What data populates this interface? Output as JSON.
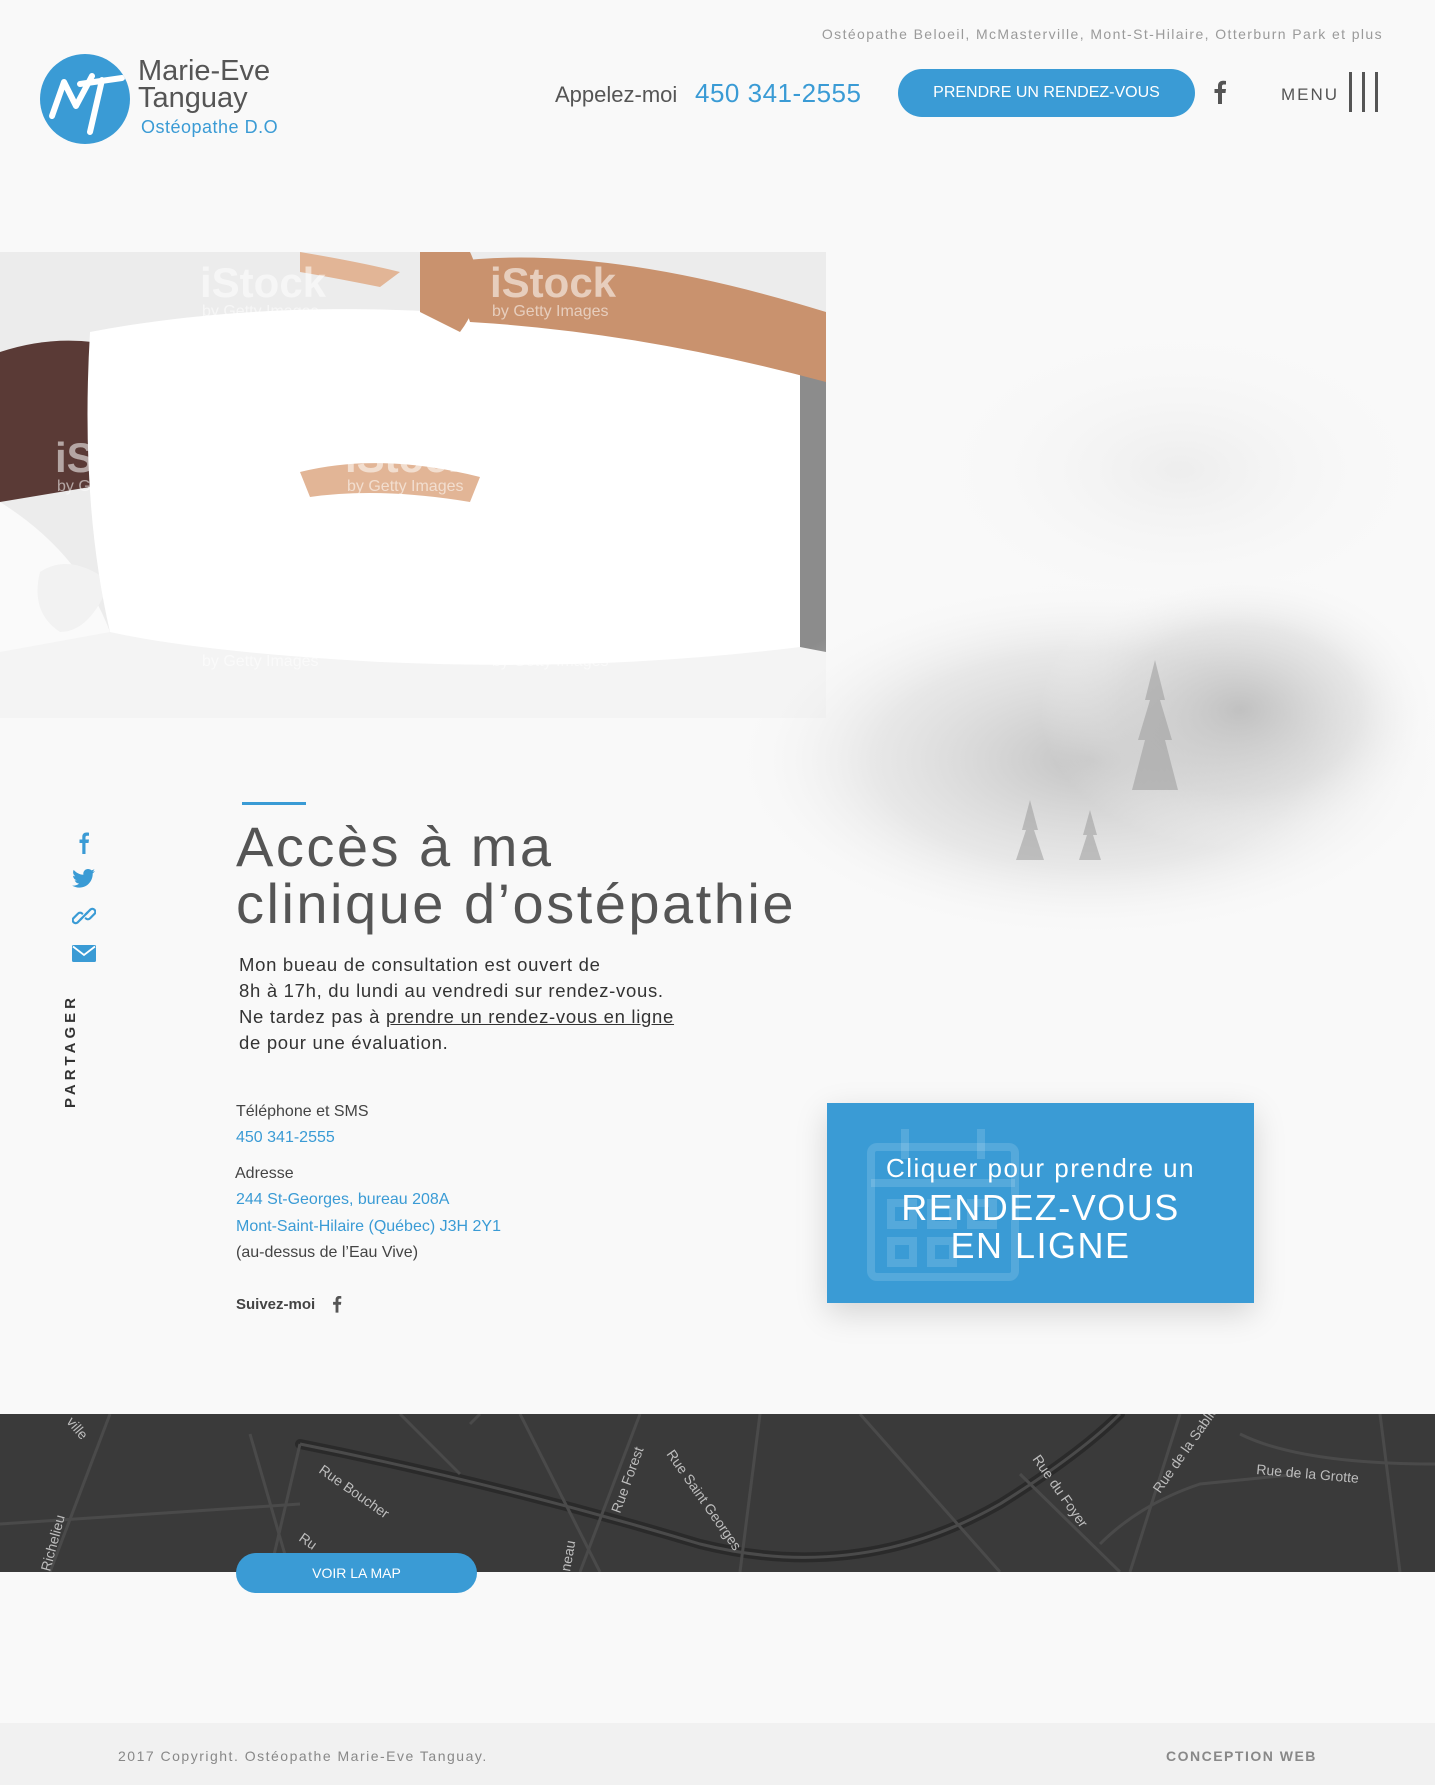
{
  "colors": {
    "accent": "#3a9bd5",
    "text": "#555555",
    "map_bg": "#3a3a3a"
  },
  "header": {
    "tagline": "Ostéopathe Beloeil, McMasterville, Mont-St-Hilaire, Otterburn Park et plus",
    "logo": {
      "initials": "MT",
      "name_line1": "Marie-Eve",
      "name_line2": "Tanguay",
      "subtitle": "Ostéopathe D.O"
    },
    "call_label": "Appelez-moi",
    "phone": "450 341-2555",
    "cta_label": "PRENDRE UN RENDEZ-VOUS",
    "social_icon": "facebook-icon",
    "menu_label": "MENU",
    "menu_icon": "hamburger-icon"
  },
  "hero": {
    "watermark": "iStock",
    "watermark_sub": "by Getty Images"
  },
  "share": {
    "label": "PARTAGER",
    "icons": [
      "facebook-icon",
      "twitter-icon",
      "link-icon",
      "mail-icon"
    ]
  },
  "main": {
    "title_line1": "Accès à ma",
    "title_line2": "clinique d’ostépathie",
    "intro_line1": "Mon bueau de consultation est ouvert de",
    "intro_line2": "8h à 17h, du lundi au vendredi sur rendez-vous.",
    "intro_line3_prefix": "Ne tardez pas à ",
    "intro_link": "prendre un rendez-vous en ligne",
    "intro_line4": "de pour une évaluation.",
    "phone_label": "Téléphone et SMS",
    "phone_value": "450 341-2555",
    "address_label": "Adresse",
    "address_line1": "244 St-Georges, bureau 208A",
    "address_line2": "Mont-Saint-Hilaire (Québec) J3H 2Y1",
    "address_note": "(au-dessus de l’Eau Vive)",
    "follow_label": "Suivez-moi"
  },
  "cta_box": {
    "line1": "Cliquer pour prendre un",
    "line2": "RENDEZ-VOUS",
    "line3": "EN LIGNE",
    "icon": "calendar-icon"
  },
  "map": {
    "button_label": "VOIR LA MAP",
    "streets": [
      "Rue Boucher",
      "Rue Forest",
      "Rue Saint Georges",
      "Rue du Foyer",
      "Rue de la Sablière",
      "Rue de la Grotte",
      "Richelieu",
      "neau",
      "Ru",
      "ville"
    ]
  },
  "footer": {
    "copyright": "2017 Copyright. Ostéopathe Marie-Eve Tanguay.",
    "credit": "CONCEPTION WEB"
  }
}
